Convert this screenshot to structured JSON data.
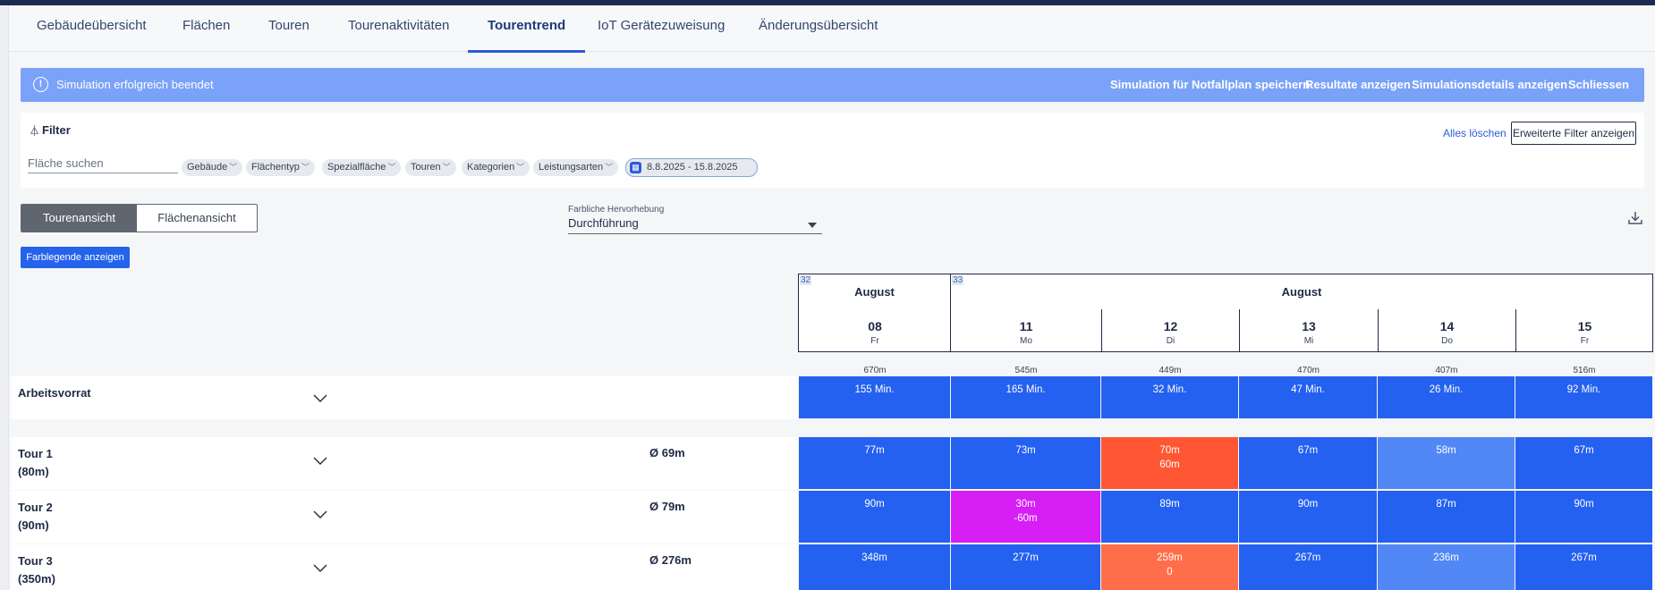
{
  "tabs": [
    {
      "label": "Gebäudeübersicht",
      "active": false
    },
    {
      "label": "Flächen",
      "active": false
    },
    {
      "label": "Touren",
      "active": false
    },
    {
      "label": "Tourenaktivitäten",
      "active": false
    },
    {
      "label": "Tourentrend",
      "active": true
    },
    {
      "label": "IoT Gerätezuweisung",
      "active": false
    },
    {
      "label": "Änderungsübersicht",
      "active": false
    }
  ],
  "banner": {
    "message": "Simulation erfolgreich beendet",
    "actions": [
      "Simulation für Notfallplan speichern",
      "Resultate anzeigen",
      "Simulationsdetails anzeigen",
      "Schliessen"
    ]
  },
  "filter": {
    "title": "Filter",
    "clear_label": "Alles löschen",
    "advanced_label": "Erweiterte Filter anzeigen",
    "search_placeholder": "Fläche suchen",
    "chips": [
      "Gebäude",
      "Flächentyp",
      "Spezialfläche",
      "Touren",
      "Kategorien",
      "Leistungsarten"
    ],
    "date_range": "8.8.2025 - 15.8.2025"
  },
  "view_toggle": {
    "active": "Tourenansicht",
    "inactive": "Flächenansicht"
  },
  "legend_button": "Farblegende anzeigen",
  "highlight": {
    "label": "Farbliche Hervorhebung",
    "value": "Durchführung"
  },
  "weeks": [
    {
      "number": "32",
      "month": "August"
    },
    {
      "number": "33",
      "month": "August"
    }
  ],
  "days": [
    {
      "num": "08",
      "weekday": "Fr",
      "total": "670m"
    },
    {
      "num": "11",
      "weekday": "Mo",
      "total": "545m"
    },
    {
      "num": "12",
      "weekday": "Di",
      "total": "449m"
    },
    {
      "num": "13",
      "weekday": "Mi",
      "total": "470m"
    },
    {
      "num": "14",
      "weekday": "Do",
      "total": "407m"
    },
    {
      "num": "15",
      "weekday": "Fr",
      "total": "516m"
    }
  ],
  "colors": {
    "blue": "#2461f0",
    "light_blue": "#5288f5",
    "orange": "#ff5733",
    "light_orange": "#ff6e4a",
    "magenta": "#d61ef5"
  },
  "rows": [
    {
      "name": "Arbeitsvorrat",
      "sub": "",
      "avg": "",
      "cells": [
        {
          "l1": "155 Min.",
          "l2": "",
          "color": "#2461f0"
        },
        {
          "l1": "165 Min.",
          "l2": "",
          "color": "#2461f0"
        },
        {
          "l1": "32 Min.",
          "l2": "",
          "color": "#2461f0"
        },
        {
          "l1": "47 Min.",
          "l2": "",
          "color": "#2461f0"
        },
        {
          "l1": "26 Min.",
          "l2": "",
          "color": "#2461f0"
        },
        {
          "l1": "92 Min.",
          "l2": "",
          "color": "#2461f0"
        }
      ]
    },
    {
      "name": "Tour 1",
      "sub": "(80m)",
      "avg": "Ø 69m",
      "cells": [
        {
          "l1": "77m",
          "l2": "",
          "color": "#2461f0"
        },
        {
          "l1": "73m",
          "l2": "",
          "color": "#2461f0"
        },
        {
          "l1": "70m",
          "l2": "60m",
          "color": "#ff5733"
        },
        {
          "l1": "67m",
          "l2": "",
          "color": "#2461f0"
        },
        {
          "l1": "58m",
          "l2": "",
          "color": "#5288f5"
        },
        {
          "l1": "67m",
          "l2": "",
          "color": "#2461f0"
        }
      ]
    },
    {
      "name": "Tour 2",
      "sub": "(90m)",
      "avg": "Ø 79m",
      "cells": [
        {
          "l1": "90m",
          "l2": "",
          "color": "#2461f0"
        },
        {
          "l1": "30m",
          "l2": "-60m",
          "color": "#d61ef5"
        },
        {
          "l1": "89m",
          "l2": "",
          "color": "#2461f0"
        },
        {
          "l1": "90m",
          "l2": "",
          "color": "#2461f0"
        },
        {
          "l1": "87m",
          "l2": "",
          "color": "#2461f0"
        },
        {
          "l1": "90m",
          "l2": "",
          "color": "#2461f0"
        }
      ]
    },
    {
      "name": "Tour 3",
      "sub": "(350m)",
      "avg": "Ø 276m",
      "cells": [
        {
          "l1": "348m",
          "l2": "",
          "color": "#2461f0"
        },
        {
          "l1": "277m",
          "l2": "",
          "color": "#2461f0"
        },
        {
          "l1": "259m",
          "l2": "0",
          "color": "#ff6e4a"
        },
        {
          "l1": "267m",
          "l2": "",
          "color": "#2461f0"
        },
        {
          "l1": "236m",
          "l2": "",
          "color": "#5288f5"
        },
        {
          "l1": "267m",
          "l2": "",
          "color": "#2461f0"
        }
      ]
    }
  ]
}
